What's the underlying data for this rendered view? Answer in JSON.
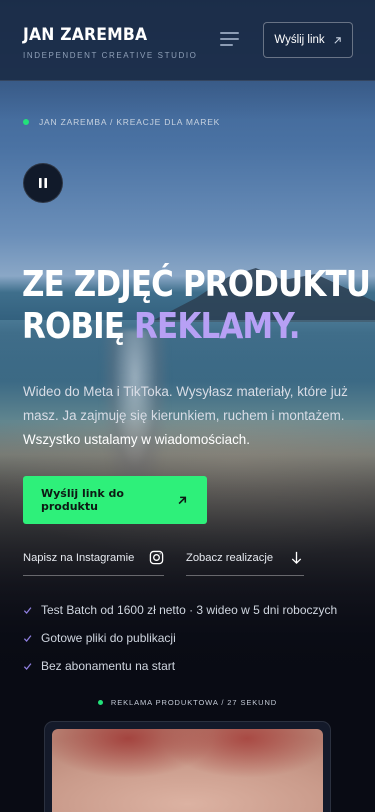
{
  "header": {
    "brand_name": "JAN ZAREMBA",
    "brand_tagline": "INDEPENDENT CREATIVE STUDIO",
    "menu_icon": "hamburger-menu-icon",
    "cta_label": "Wyślij link",
    "cta_icon": "arrow-up-right-icon"
  },
  "hero": {
    "breadcrumb": "JAN ZAREMBA / KREACJE DLA MAREK",
    "pause_icon": "pause-icon",
    "headline_line1": "ZE ZDJĘĆ PRODUKTU",
    "headline_line2_prefix": "ROBIĘ ",
    "headline_line2_accent": "REKLAMY.",
    "lead": "Wideo do Meta i TikToka. Wysyłasz materiały, które już masz. Ja zajmuję się kierunkiem, ruchem i montażem.",
    "lead_strong": "Wszystko ustalamy w wiadomościach.",
    "primary_cta": "Wyślij link do produktu",
    "primary_cta_icon": "arrow-up-right-icon",
    "instagram_link": "Napisz na Instagramie",
    "instagram_icon": "instagram-icon",
    "work_link": "Zobacz realizacje",
    "work_icon": "arrow-down-icon",
    "checklist": [
      "Test Batch od 1600 zł netto · 3 wideo w 5 dni roboczych",
      "Gotowe pliki do publikacji",
      "Bez abonamentu na start"
    ]
  },
  "video": {
    "caption": "REKLAMA PRODUKTOWA / 27 SEKUND"
  },
  "colors": {
    "accent_green": "#2ef07a",
    "accent_purple": "#b7a0f5",
    "header_bg": "#1b2d48"
  }
}
